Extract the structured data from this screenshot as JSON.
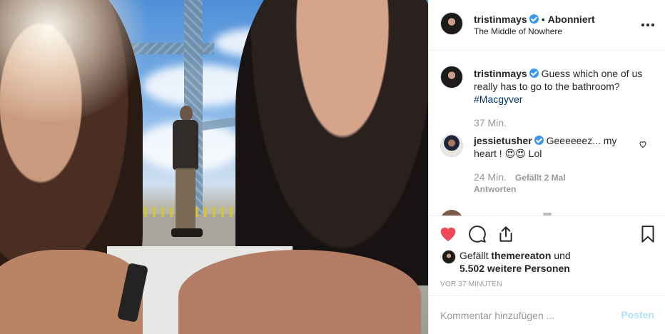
{
  "post": {
    "author": {
      "username": "tristinmays",
      "verified": true,
      "follow_separator": "•",
      "follow_status": "Abonniert",
      "location": "The Middle of Nowhere"
    },
    "caption": {
      "username": "tristinmays",
      "text": "Guess which one of us really has to go to the bathroom?",
      "hashtag": "#Macgyver",
      "time": "37 Min."
    },
    "comments": [
      {
        "username": "jessietusher",
        "verified": true,
        "text": "Geeeeeez... my heart ! 😍😍 Lol",
        "time": "24 Min.",
        "likes": "Gefällt 2 Mal",
        "reply_label": "Antworten"
      }
    ],
    "likes": {
      "prefix": "Gefällt",
      "liked_by_user": "themereaton",
      "conjunction": "und",
      "others": "5.502 weitere Personen"
    },
    "timestamp": "VOR 37 MINUTEN",
    "add_comment": {
      "placeholder": "Kommentar hinzufügen ...",
      "post_label": "Posten"
    },
    "colors": {
      "like_red": "#ed4956",
      "verified_blue": "#3897f0",
      "hashtag_blue": "#003569",
      "muted_text": "#999999",
      "post_button_disabled": "#b2dffc"
    }
  }
}
